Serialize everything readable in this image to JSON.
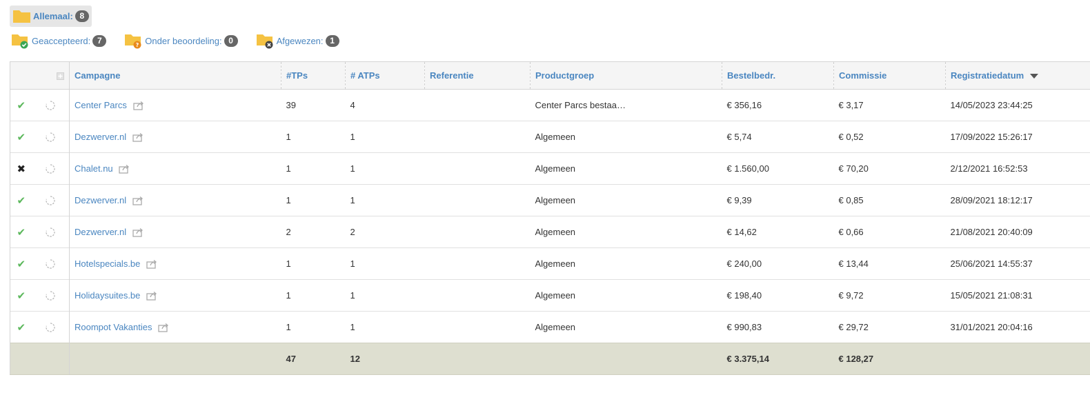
{
  "filters": {
    "all": {
      "label": "Allemaal:",
      "count": "8"
    },
    "accepted": {
      "label": "Geaccepteerd:",
      "count": "7"
    },
    "review": {
      "label": "Onder beoordeling:",
      "count": "0"
    },
    "rejected": {
      "label": "Afgewezen:",
      "count": "1"
    }
  },
  "table": {
    "headers": {
      "campaign": "Campagne",
      "tps": "#TPs",
      "atps": "# ATPs",
      "reference": "Referentie",
      "productgroup": "Productgroep",
      "order_amount": "Bestelbedr.",
      "commission": "Commissie",
      "regdate": "Registratiedatum"
    },
    "rows": [
      {
        "status": "accepted",
        "campaign": "Center Parcs",
        "tps": "39",
        "atps": "4",
        "reference": "",
        "productgroup": "Center Parcs bestaa…",
        "order_amount": "€ 356,16",
        "commission": "€ 3,17",
        "regdate": "14/05/2023 23:44:25"
      },
      {
        "status": "accepted",
        "campaign": "Dezwerver.nl",
        "tps": "1",
        "atps": "1",
        "reference": "",
        "productgroup": "Algemeen",
        "order_amount": "€ 5,74",
        "commission": "€ 0,52",
        "regdate": "17/09/2022 15:26:17"
      },
      {
        "status": "rejected",
        "campaign": "Chalet.nu",
        "tps": "1",
        "atps": "1",
        "reference": "",
        "productgroup": "Algemeen",
        "order_amount": "€ 1.560,00",
        "commission": "€ 70,20",
        "regdate": "2/12/2021 16:52:53"
      },
      {
        "status": "accepted",
        "campaign": "Dezwerver.nl",
        "tps": "1",
        "atps": "1",
        "reference": "",
        "productgroup": "Algemeen",
        "order_amount": "€ 9,39",
        "commission": "€ 0,85",
        "regdate": "28/09/2021 18:12:17"
      },
      {
        "status": "accepted",
        "campaign": "Dezwerver.nl",
        "tps": "2",
        "atps": "2",
        "reference": "",
        "productgroup": "Algemeen",
        "order_amount": "€ 14,62",
        "commission": "€ 0,66",
        "regdate": "21/08/2021 20:40:09"
      },
      {
        "status": "accepted",
        "campaign": "Hotelspecials.be",
        "tps": "1",
        "atps": "1",
        "reference": "",
        "productgroup": "Algemeen",
        "order_amount": "€ 240,00",
        "commission": "€ 13,44",
        "regdate": "25/06/2021 14:55:37"
      },
      {
        "status": "accepted",
        "campaign": "Holidaysuites.be",
        "tps": "1",
        "atps": "1",
        "reference": "",
        "productgroup": "Algemeen",
        "order_amount": "€ 198,40",
        "commission": "€ 9,72",
        "regdate": "15/05/2021 21:08:31"
      },
      {
        "status": "accepted",
        "campaign": "Roompot Vakanties",
        "tps": "1",
        "atps": "1",
        "reference": "",
        "productgroup": "Algemeen",
        "order_amount": "€ 990,83",
        "commission": "€ 29,72",
        "regdate": "31/01/2021 20:04:16"
      }
    ],
    "totals": {
      "tps": "47",
      "atps": "12",
      "order_amount": "€ 3.375,14",
      "commission": "€ 128,27"
    }
  },
  "colors": {
    "link": "#4a86c0",
    "accepted": "#5cb85c",
    "folder": "#f5c242",
    "footer_bg": "#dedfd0"
  }
}
